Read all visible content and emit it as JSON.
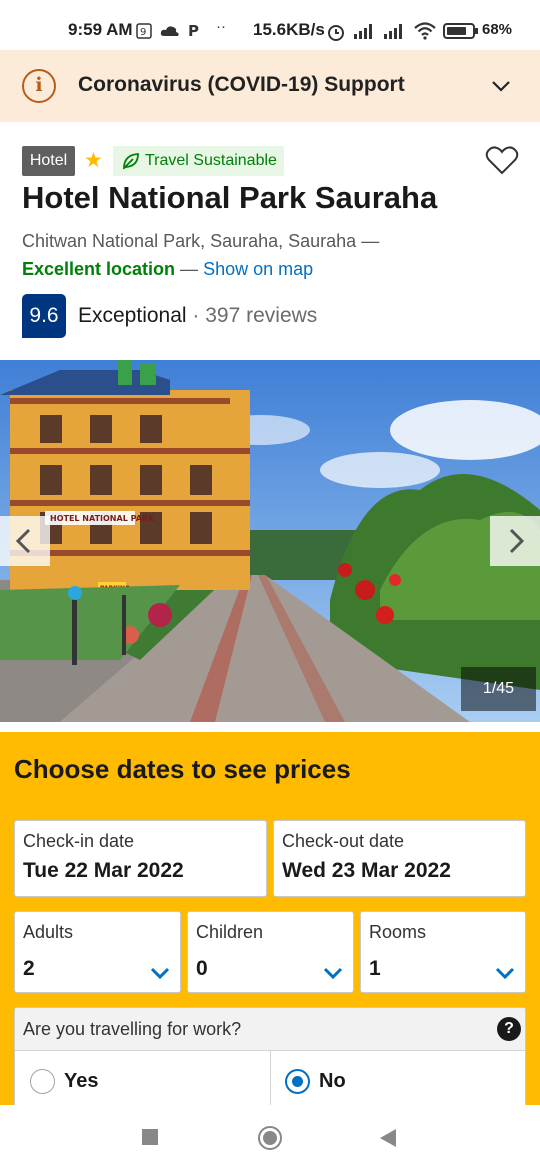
{
  "status_bar": {
    "time": "9:59 AM",
    "net_speed": "15.6KB/s",
    "battery": "68%"
  },
  "covid_banner": {
    "title": "Coronavirus (COVID-19) Support",
    "icon": "info-icon"
  },
  "hotel": {
    "type_badge": "Hotel",
    "stars": 1,
    "sustainable_label": "Travel Sustainable",
    "name": "Hotel National Park Sauraha",
    "address": "Chitwan National Park, Sauraha, Sauraha —",
    "location_rating": "Excellent location",
    "location_sep": " — ",
    "show_on_map": "Show on map",
    "score": "9.6",
    "score_word": "Exceptional",
    "score_sep": " · ",
    "reviews": "397 reviews"
  },
  "gallery": {
    "counter": "1/45",
    "sign_text": "HOTEL NATIONAL PARK",
    "parking_text": "PARKING"
  },
  "booking": {
    "heading": "Choose dates to see prices",
    "checkin_label": "Check-in date",
    "checkin_value": "Tue 22 Mar 2022",
    "checkout_label": "Check-out date",
    "checkout_value": "Wed 23 Mar 2022",
    "adults_label": "Adults",
    "adults_value": "2",
    "children_label": "Children",
    "children_value": "0",
    "rooms_label": "Rooms",
    "rooms_value": "1",
    "work_question": "Are you travelling for work?",
    "help_glyph": "?",
    "yes_label": "Yes",
    "no_label": "No",
    "selected": "No"
  },
  "colors": {
    "brand_blue": "#003580",
    "link_blue": "#0071c2",
    "accent_yellow": "#febb02",
    "good_green": "#008009",
    "banner_bg": "#fcebd9"
  }
}
